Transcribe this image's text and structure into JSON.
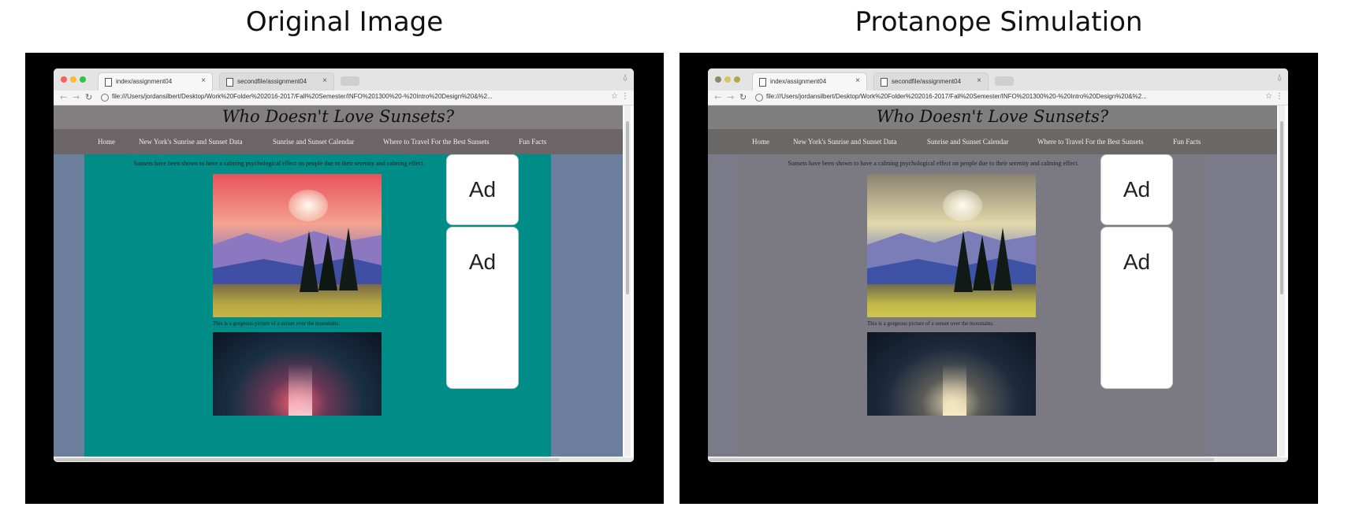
{
  "panels": [
    {
      "title": "Original Image",
      "colors": {
        "header_bg": "#837f80",
        "nav_bg": "#6c6567",
        "side_bg": "#6b7e9c",
        "main_bg": "#008c87",
        "sky_top": "#e8525c",
        "sky_mid": "#f3a38f",
        "mountain_far": "#8b78c0",
        "mountain_near": "#3f4fa3",
        "grass": "#b6a841",
        "night_sky": "#1a2f45",
        "night_glow": "#f06070"
      }
    },
    {
      "title": "Protanope Simulation",
      "colors": {
        "header_bg": "#807f7f",
        "nav_bg": "#6a6767",
        "side_bg": "#7a7a88",
        "main_bg": "#7b7a82",
        "sky_top": "#8a8270",
        "sky_mid": "#e2d9ab",
        "mountain_far": "#7a7db8",
        "mountain_near": "#3e52a6",
        "grass": "#c1b84a",
        "night_sky": "#1e2b3e",
        "night_glow": "#d8cca8"
      }
    }
  ],
  "browser": {
    "tabs": [
      "index/assignment04",
      "secondfile/assignment04"
    ],
    "tab_close": "×",
    "url": "file:///Users/jordansilbert/Desktop/Work%20Folder%202016-2017/Fall%20Semester/INFO%201300%20-%20Intro%20Design%20&%2..."
  },
  "site": {
    "title": "Who Doesn't Love Sunsets?",
    "nav": [
      "Home",
      "New York's Sunrise and Sunset Data",
      "Sunrise and Sunset Calendar",
      "Where to Travel For the Best Sunsets",
      "Fun Facts"
    ],
    "intro": "Sunsets have been shown to have a calming psychological effect on people due to their serenity and calming effect.",
    "caption": "This is a gorgeous picture of a sunset over the mountains.",
    "ads": [
      "Ad",
      "Ad"
    ]
  }
}
